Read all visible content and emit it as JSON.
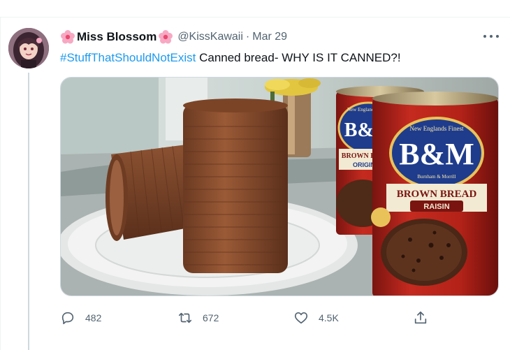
{
  "tweet": {
    "display_name": "Miss Blossom",
    "handle": "@KissKawaii",
    "separator": "·",
    "date": "Mar 29",
    "hashtag": "#StuffThatShouldNotExist",
    "text": " Canned bread- WHY IS IT CANNED?!"
  },
  "media": {
    "can_front": {
      "tagline": "New Englands Finest",
      "brand": "B&M",
      "maker": "Burnham & Morrill",
      "product": "BROWN BREAD",
      "variant": "RAISIN"
    },
    "can_back": {
      "tagline": "New Englands Finest",
      "brand": "B&M",
      "product": "BROWN BREAD",
      "variant": "ORIGINAL"
    }
  },
  "actions": {
    "replies": "482",
    "retweets": "672",
    "likes": "4.5K"
  },
  "colors": {
    "accent": "#1d9bf0",
    "secondary_text": "#536471",
    "divider": "#cfd9de"
  },
  "icons": [
    "flower-icon",
    "more-icon",
    "reply-icon",
    "retweet-icon",
    "like-icon",
    "share-icon"
  ]
}
